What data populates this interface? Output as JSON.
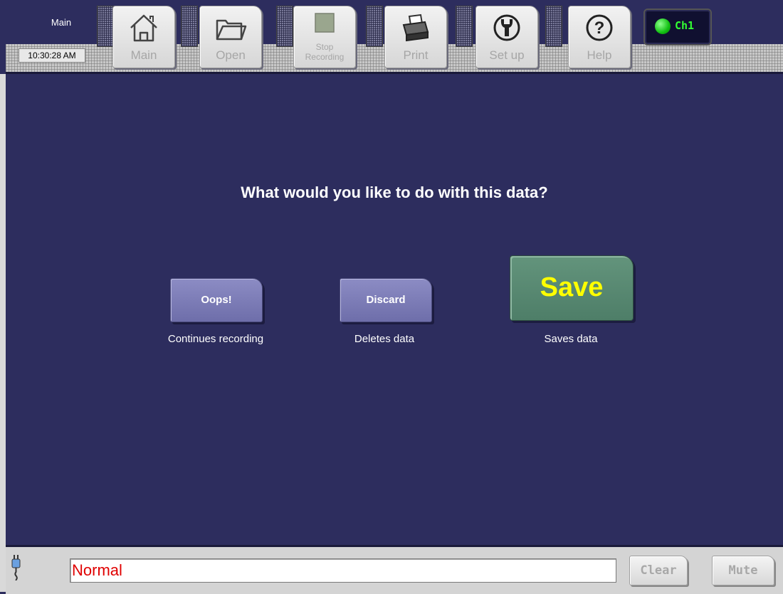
{
  "header": {
    "mode_label": "Main",
    "clock": "10:30:28 AM",
    "toolbar": [
      {
        "label": "Main",
        "icon": "home-icon"
      },
      {
        "label": "Open",
        "icon": "folder-icon"
      },
      {
        "label": "Stop Recording",
        "icon": "stop-icon"
      },
      {
        "label": "Print",
        "icon": "printer-icon"
      },
      {
        "label": "Set up",
        "icon": "wrench-icon"
      },
      {
        "label": "Help",
        "icon": "help-icon"
      }
    ],
    "channel": {
      "label": "Ch1",
      "status_color": "#22dd22"
    }
  },
  "dialog": {
    "prompt": "What would you like to do with this data?",
    "options": [
      {
        "label": "Oops!",
        "caption": "Continues recording"
      },
      {
        "label": "Discard",
        "caption": "Deletes data"
      },
      {
        "label": "Save",
        "caption": "Saves data"
      }
    ]
  },
  "statusbar": {
    "icon": "power-plug-icon",
    "status_text": "Normal",
    "clear_label": "Clear",
    "mute_label": "Mute"
  },
  "colors": {
    "background": "#2d2d5e",
    "save_button": "#5a8a74",
    "save_text": "#ffff00",
    "option_button": "#7e7eb8",
    "status_text": "#e00000",
    "channel_led": "#22dd22"
  }
}
